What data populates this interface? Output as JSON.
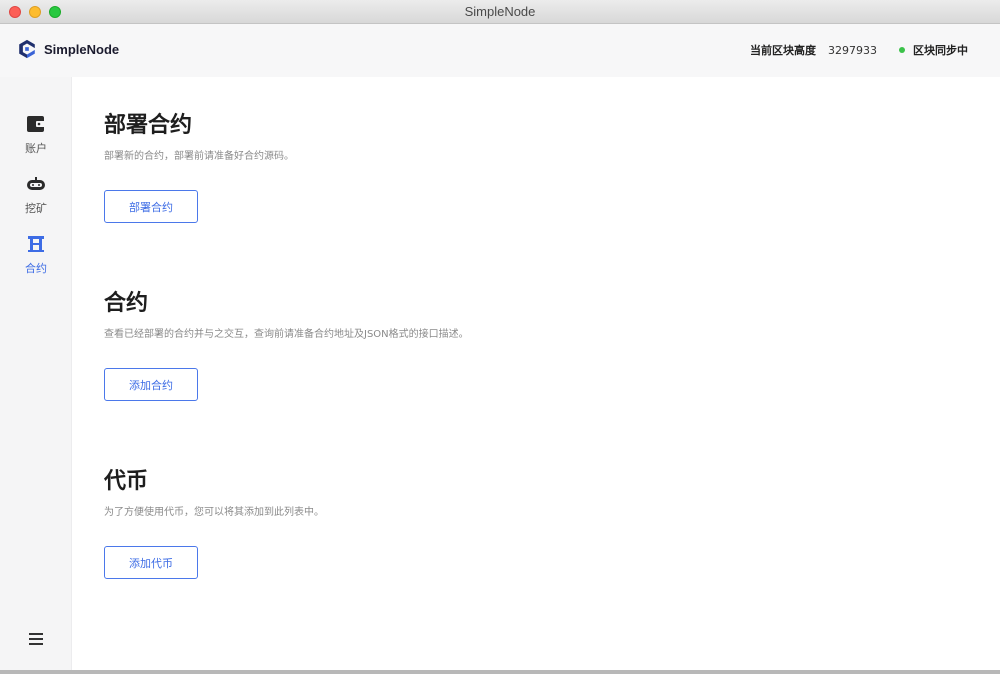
{
  "window": {
    "title": "SimpleNode"
  },
  "header": {
    "brand_name": "SimpleNode",
    "block_height_label": "当前区块高度",
    "block_height_value": "3297933",
    "sync_status": "区块同步中",
    "sync_color": "#3bc24a"
  },
  "sidebar": {
    "items": [
      {
        "label": "账户",
        "icon": "wallet-icon",
        "active": false
      },
      {
        "label": "挖矿",
        "icon": "mining-icon",
        "active": false
      },
      {
        "label": "合约",
        "icon": "contract-icon",
        "active": true
      }
    ],
    "menu_icon": "hamburger-menu-icon",
    "accent_color": "#3d6ce5"
  },
  "sections": [
    {
      "title": "部署合约",
      "description": "部署新的合约，部署前请准备好合约源码。",
      "button_label": "部署合约"
    },
    {
      "title": "合约",
      "description": "查看已经部署的合约并与之交互，查询前请准备合约地址及JSON格式的接口描述。",
      "button_label": "添加合约"
    },
    {
      "title": "代币",
      "description": "为了方便使用代币，您可以将其添加到此列表中。",
      "button_label": "添加代币"
    }
  ]
}
